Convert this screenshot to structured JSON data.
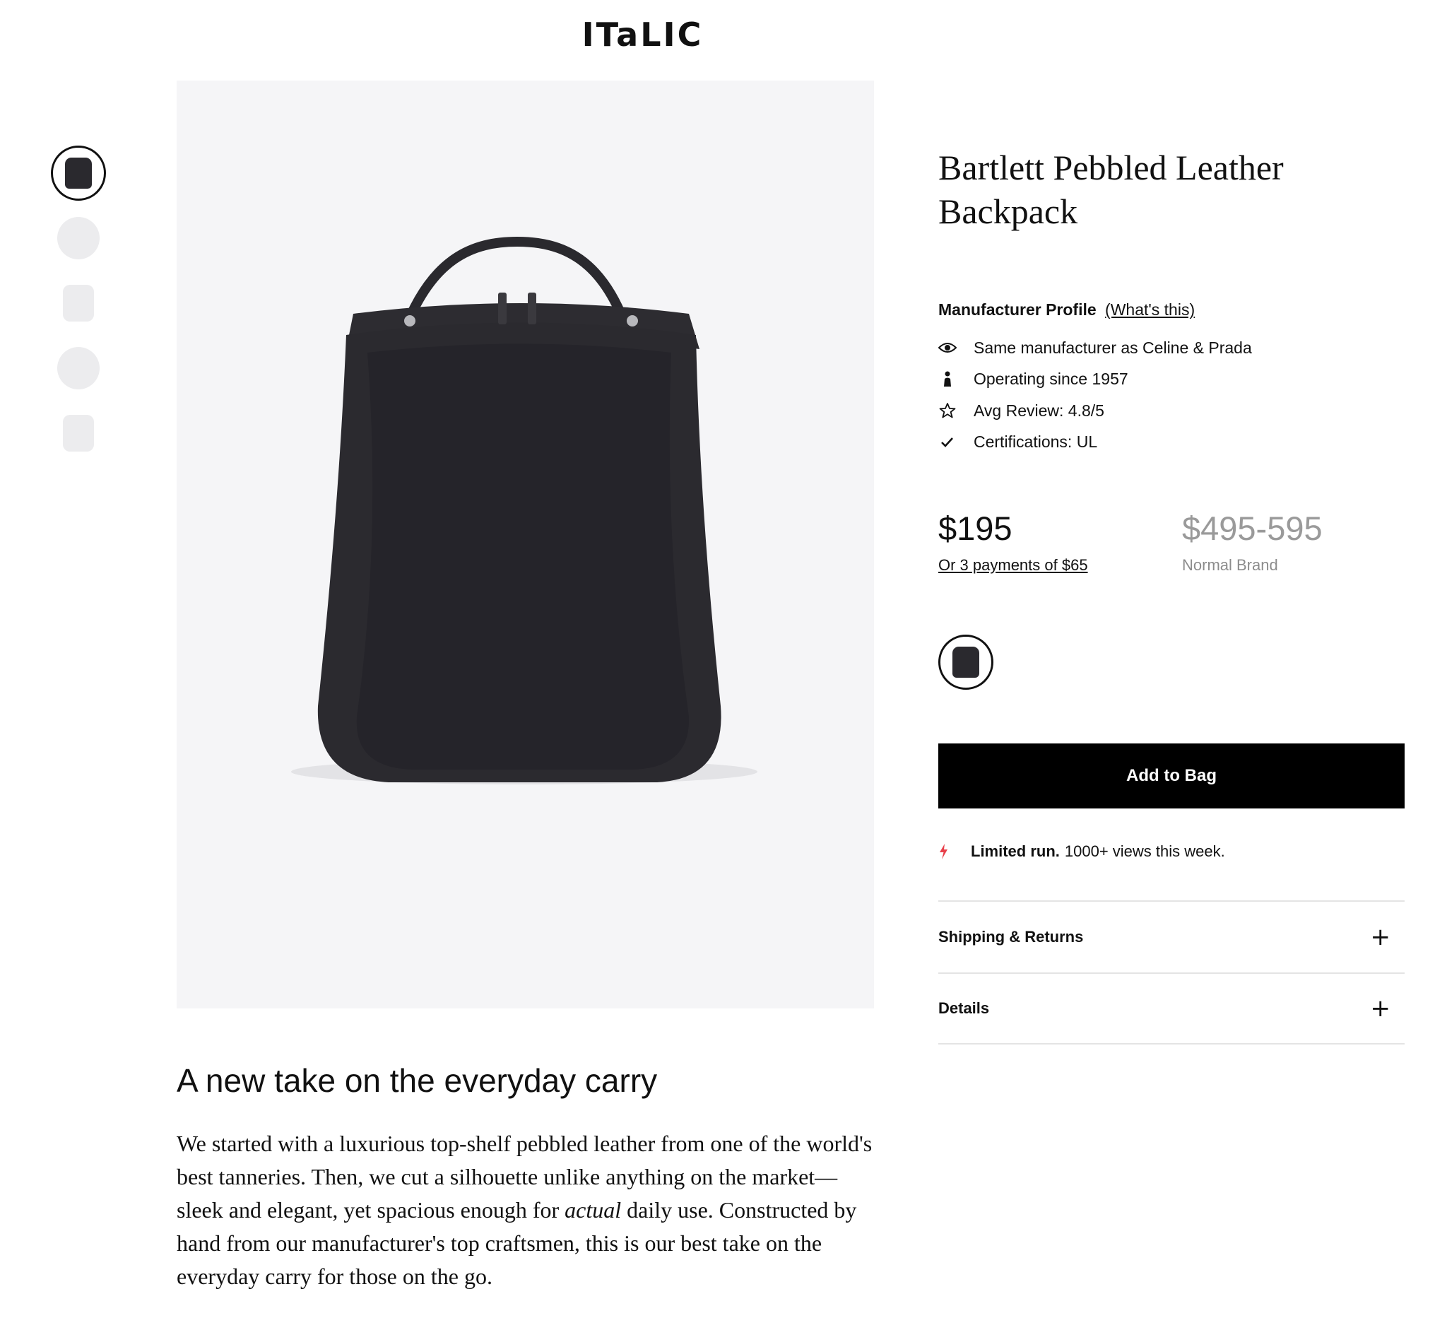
{
  "brand": {
    "logo_text": "ITaLIC"
  },
  "gallery": {
    "thumbnails": [
      "backpack-front",
      "bag-alt-1",
      "bag-alt-2",
      "bag-alt-3",
      "bag-alt-4"
    ]
  },
  "product": {
    "title": "Bartlett Pebbled Leather Backpack",
    "manufacturer_profile": {
      "heading": "Manufacturer Profile",
      "link": "(What's this)",
      "features": [
        {
          "icon": "eye-icon",
          "text": "Same manufacturer as Celine & Prada"
        },
        {
          "icon": "person-icon",
          "text": "Operating since 1957"
        },
        {
          "icon": "star-icon",
          "text": "Avg Review: 4.8/5"
        },
        {
          "icon": "check-icon",
          "text": "Certifications: UL"
        }
      ]
    },
    "price": "$195",
    "payment_plan": "Or 3 payments of $65",
    "normal_price": "$495-595",
    "normal_label": "Normal Brand",
    "add_to_bag": "Add to Bag",
    "limited": {
      "bold": "Limited run.",
      "text": "1000+ views this week."
    },
    "accordions": [
      {
        "label": "Shipping & Returns"
      },
      {
        "label": "Details"
      }
    ]
  },
  "description": {
    "title": "A new take on the everyday carry",
    "body_before": "We started with a luxurious top-shelf pebbled leather from one of the world's best tanneries. Then, we cut a silhouette unlike anything on the market—sleek and elegant, yet spacious enough for ",
    "body_italic": "actual",
    "body_after": " daily use. Constructed by hand from our manufacturer's top craftsmen, this is our best take on the everyday carry for those on the go."
  },
  "colors": {
    "accent": "#000000",
    "bolt": "#e8414b",
    "muted": "#9a9a9a",
    "hero_bg": "#f5f5f7"
  }
}
